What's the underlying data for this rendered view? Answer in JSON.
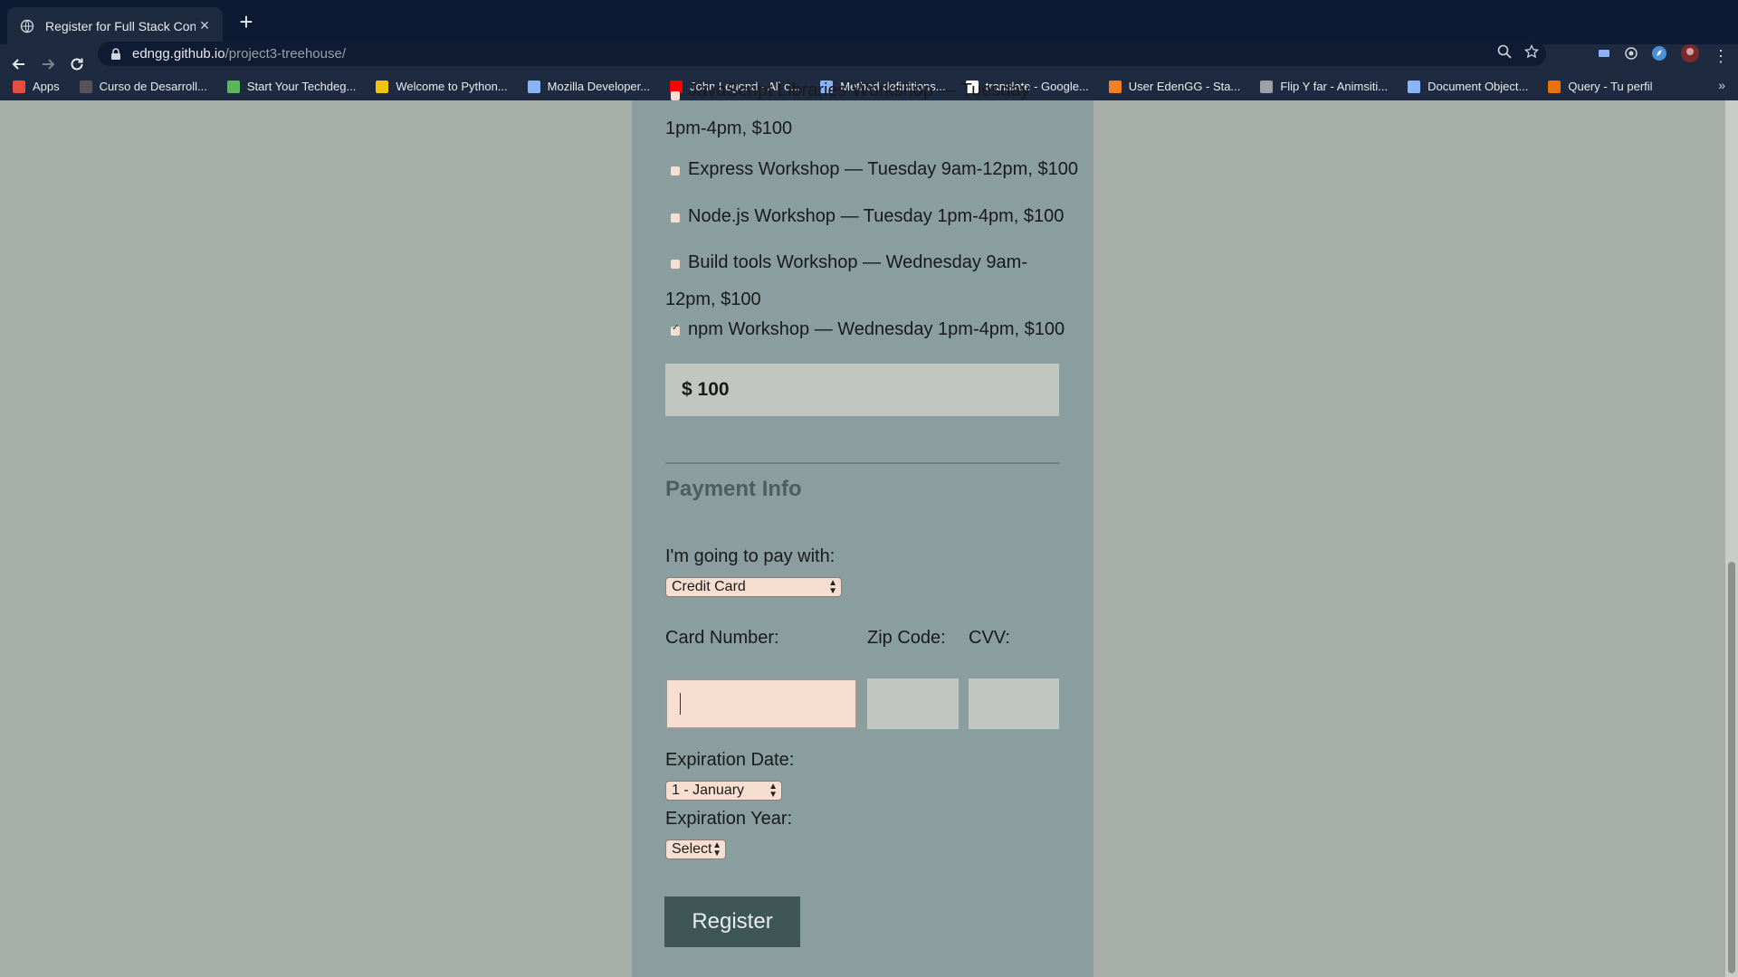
{
  "browser": {
    "tab_title": "Register for Full Stack Conf",
    "url_host": "edngg.github.io",
    "url_path": "/project3-treehouse/",
    "bookmarks": [
      {
        "label": "Apps",
        "color": "#e74c3c"
      },
      {
        "label": "Curso de Desarroll...",
        "color": "#555555"
      },
      {
        "label": "Start Your Techdeg...",
        "color": "#5cb85c"
      },
      {
        "label": "Welcome to Python...",
        "color": "#f1c40f"
      },
      {
        "label": "Mozilla Developer...",
        "color": "#8ab4f8"
      },
      {
        "label": "John Legend - All o...",
        "color": "#ff0000"
      },
      {
        "label": "Method definitions...",
        "color": "#8ab4f8"
      },
      {
        "label": "translate - Google...",
        "color": "#ffffff"
      },
      {
        "label": "User EdenGG - Sta...",
        "color": "#f48024"
      },
      {
        "label": "Flip Y far - Animsiti...",
        "color": "#9aa0a6"
      },
      {
        "label": "Document Object...",
        "color": "#8ab4f8"
      },
      {
        "label": "Query - Tu perfil",
        "color": "#e8710a"
      }
    ]
  },
  "activities": {
    "workshops": [
      {
        "line1": "JavaScript Libraries Workshop — Tuesday",
        "line2": "1pm-4pm, $100",
        "checked": false
      },
      {
        "line1": "Express Workshop — Tuesday 9am-12pm, $100",
        "line2": "",
        "checked": false
      },
      {
        "line1": "Node.js Workshop — Tuesday 1pm-4pm, $100",
        "line2": "",
        "checked": false
      },
      {
        "line1": "Build tools Workshop — Wednesday 9am-",
        "line2": "12pm, $100",
        "checked": false
      },
      {
        "line1": "npm Workshop — Wednesday 1pm-4pm, $100",
        "line2": "",
        "checked": true
      }
    ],
    "total_label": "$ 100"
  },
  "payment": {
    "title": "Payment Info",
    "pay_with_label": "I'm going to pay with:",
    "pay_with_value": "Credit Card",
    "card_number_label": "Card Number:",
    "zip_label": "Zip Code:",
    "cvv_label": "CVV:",
    "exp_date_label": "Expiration Date:",
    "exp_date_value": "1 - January",
    "exp_year_label": "Expiration Year:",
    "exp_year_value": "Select"
  },
  "register_label": "Register"
}
